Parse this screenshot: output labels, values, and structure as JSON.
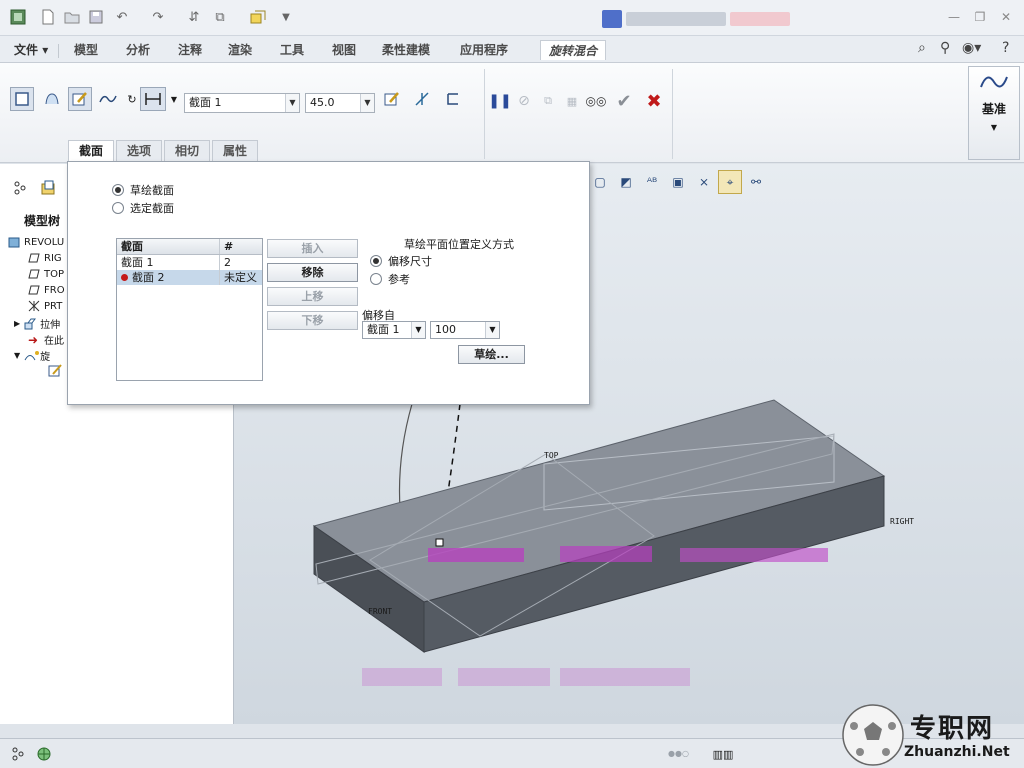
{
  "ribbon_tabs": {
    "file": "文件",
    "items": [
      "模型",
      "分析",
      "注释",
      "渲染",
      "工具",
      "视图",
      "柔性建模",
      "应用程序"
    ],
    "active": "旋转混合"
  },
  "dashboard": {
    "section_select": "截面 1",
    "angle_value": "45.0",
    "datum_label": "基准",
    "subtabs": [
      "截面",
      "选项",
      "相切",
      "属性"
    ]
  },
  "model_tree": {
    "title": "模型树",
    "items": [
      {
        "label": "REVOLU",
        "icon": "part-icon"
      },
      {
        "label": "RIG",
        "icon": "plane-icon"
      },
      {
        "label": "TOP",
        "icon": "plane-icon"
      },
      {
        "label": "FRO",
        "icon": "plane-icon"
      },
      {
        "label": "PRT",
        "icon": "csys-icon"
      },
      {
        "label": "拉伸",
        "icon": "extrude-icon"
      },
      {
        "label": "在此",
        "icon": "insert-arrow-icon"
      },
      {
        "label": "旋",
        "icon": "revolve-blend-icon"
      }
    ]
  },
  "sections_panel": {
    "radio_sketched": "草绘截面",
    "radio_selected": "选定截面",
    "table_headers": [
      "截面",
      "#"
    ],
    "rows": [
      {
        "name": "截面 1",
        "num": "2"
      },
      {
        "name": "截面 2",
        "num": "未定义"
      }
    ],
    "buttons": {
      "insert": "插入",
      "remove": "移除",
      "up": "上移",
      "down": "下移"
    },
    "placement_title": "草绘平面位置定义方式",
    "radio_offset": "偏移尺寸",
    "radio_reference": "参考",
    "offset_from_label": "偏移自",
    "offset_from_value": "截面 1",
    "offset_value": "100",
    "sketch_button": "草绘..."
  },
  "graphics": {
    "datum_top": "TOP",
    "datum_right": "RIGHT",
    "datum_front": "FRONT"
  },
  "watermark": {
    "cn": "专职网",
    "en": "Zhuanzhi.Net"
  }
}
